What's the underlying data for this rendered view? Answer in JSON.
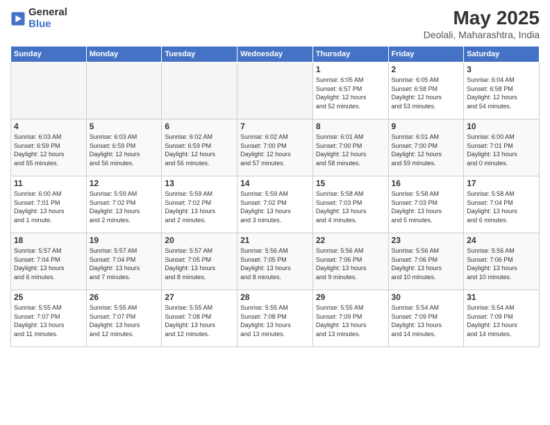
{
  "logo": {
    "general": "General",
    "blue": "Blue"
  },
  "header": {
    "title": "May 2025",
    "subtitle": "Deolali, Maharashtra, India"
  },
  "weekdays": [
    "Sunday",
    "Monday",
    "Tuesday",
    "Wednesday",
    "Thursday",
    "Friday",
    "Saturday"
  ],
  "weeks": [
    [
      {
        "day": "",
        "info": ""
      },
      {
        "day": "",
        "info": ""
      },
      {
        "day": "",
        "info": ""
      },
      {
        "day": "",
        "info": ""
      },
      {
        "day": "1",
        "info": "Sunrise: 6:05 AM\nSunset: 6:57 PM\nDaylight: 12 hours\nand 52 minutes."
      },
      {
        "day": "2",
        "info": "Sunrise: 6:05 AM\nSunset: 6:58 PM\nDaylight: 12 hours\nand 53 minutes."
      },
      {
        "day": "3",
        "info": "Sunrise: 6:04 AM\nSunset: 6:58 PM\nDaylight: 12 hours\nand 54 minutes."
      }
    ],
    [
      {
        "day": "4",
        "info": "Sunrise: 6:03 AM\nSunset: 6:59 PM\nDaylight: 12 hours\nand 55 minutes."
      },
      {
        "day": "5",
        "info": "Sunrise: 6:03 AM\nSunset: 6:59 PM\nDaylight: 12 hours\nand 56 minutes."
      },
      {
        "day": "6",
        "info": "Sunrise: 6:02 AM\nSunset: 6:59 PM\nDaylight: 12 hours\nand 56 minutes."
      },
      {
        "day": "7",
        "info": "Sunrise: 6:02 AM\nSunset: 7:00 PM\nDaylight: 12 hours\nand 57 minutes."
      },
      {
        "day": "8",
        "info": "Sunrise: 6:01 AM\nSunset: 7:00 PM\nDaylight: 12 hours\nand 58 minutes."
      },
      {
        "day": "9",
        "info": "Sunrise: 6:01 AM\nSunset: 7:00 PM\nDaylight: 12 hours\nand 59 minutes."
      },
      {
        "day": "10",
        "info": "Sunrise: 6:00 AM\nSunset: 7:01 PM\nDaylight: 13 hours\nand 0 minutes."
      }
    ],
    [
      {
        "day": "11",
        "info": "Sunrise: 6:00 AM\nSunset: 7:01 PM\nDaylight: 13 hours\nand 1 minute."
      },
      {
        "day": "12",
        "info": "Sunrise: 5:59 AM\nSunset: 7:02 PM\nDaylight: 13 hours\nand 2 minutes."
      },
      {
        "day": "13",
        "info": "Sunrise: 5:59 AM\nSunset: 7:02 PM\nDaylight: 13 hours\nand 2 minutes."
      },
      {
        "day": "14",
        "info": "Sunrise: 5:59 AM\nSunset: 7:02 PM\nDaylight: 13 hours\nand 3 minutes."
      },
      {
        "day": "15",
        "info": "Sunrise: 5:58 AM\nSunset: 7:03 PM\nDaylight: 13 hours\nand 4 minutes."
      },
      {
        "day": "16",
        "info": "Sunrise: 5:58 AM\nSunset: 7:03 PM\nDaylight: 13 hours\nand 5 minutes."
      },
      {
        "day": "17",
        "info": "Sunrise: 5:58 AM\nSunset: 7:04 PM\nDaylight: 13 hours\nand 6 minutes."
      }
    ],
    [
      {
        "day": "18",
        "info": "Sunrise: 5:57 AM\nSunset: 7:04 PM\nDaylight: 13 hours\nand 6 minutes."
      },
      {
        "day": "19",
        "info": "Sunrise: 5:57 AM\nSunset: 7:04 PM\nDaylight: 13 hours\nand 7 minutes."
      },
      {
        "day": "20",
        "info": "Sunrise: 5:57 AM\nSunset: 7:05 PM\nDaylight: 13 hours\nand 8 minutes."
      },
      {
        "day": "21",
        "info": "Sunrise: 5:56 AM\nSunset: 7:05 PM\nDaylight: 13 hours\nand 8 minutes."
      },
      {
        "day": "22",
        "info": "Sunrise: 5:56 AM\nSunset: 7:06 PM\nDaylight: 13 hours\nand 9 minutes."
      },
      {
        "day": "23",
        "info": "Sunrise: 5:56 AM\nSunset: 7:06 PM\nDaylight: 13 hours\nand 10 minutes."
      },
      {
        "day": "24",
        "info": "Sunrise: 5:56 AM\nSunset: 7:06 PM\nDaylight: 13 hours\nand 10 minutes."
      }
    ],
    [
      {
        "day": "25",
        "info": "Sunrise: 5:55 AM\nSunset: 7:07 PM\nDaylight: 13 hours\nand 11 minutes."
      },
      {
        "day": "26",
        "info": "Sunrise: 5:55 AM\nSunset: 7:07 PM\nDaylight: 13 hours\nand 12 minutes."
      },
      {
        "day": "27",
        "info": "Sunrise: 5:55 AM\nSunset: 7:08 PM\nDaylight: 13 hours\nand 12 minutes."
      },
      {
        "day": "28",
        "info": "Sunrise: 5:55 AM\nSunset: 7:08 PM\nDaylight: 13 hours\nand 13 minutes."
      },
      {
        "day": "29",
        "info": "Sunrise: 5:55 AM\nSunset: 7:09 PM\nDaylight: 13 hours\nand 13 minutes."
      },
      {
        "day": "30",
        "info": "Sunrise: 5:54 AM\nSunset: 7:09 PM\nDaylight: 13 hours\nand 14 minutes."
      },
      {
        "day": "31",
        "info": "Sunrise: 5:54 AM\nSunset: 7:09 PM\nDaylight: 13 hours\nand 14 minutes."
      }
    ]
  ]
}
